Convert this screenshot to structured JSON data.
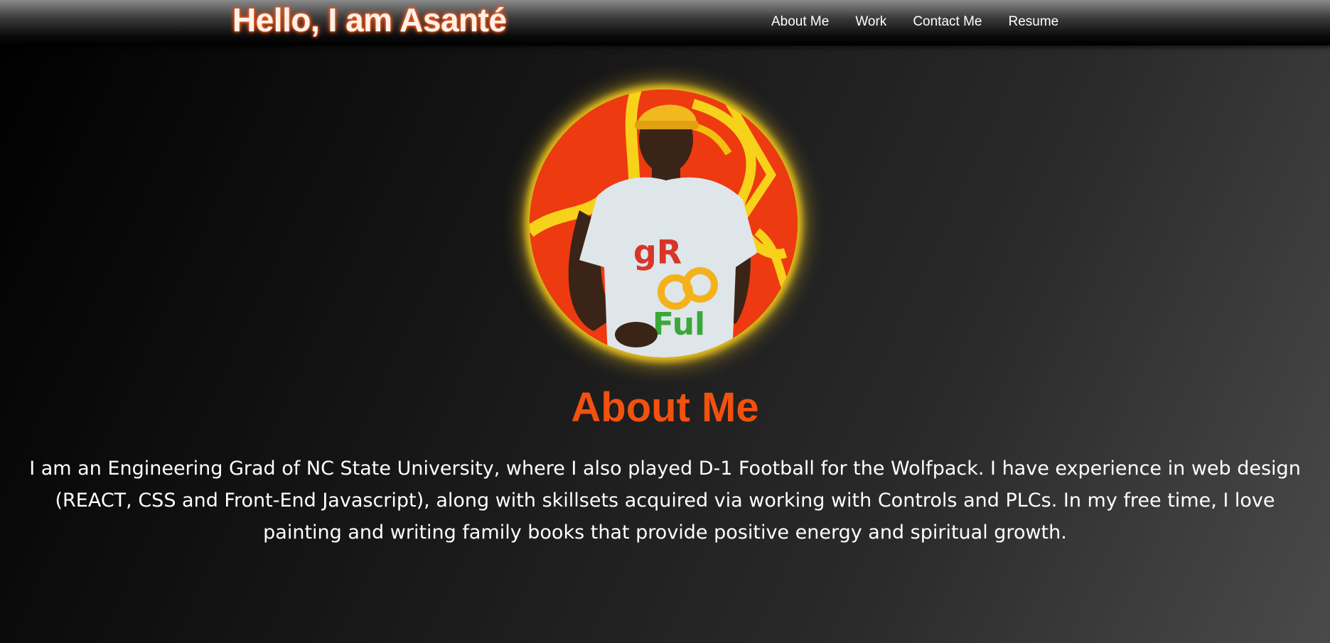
{
  "header": {
    "brand": "Hello, I am Asanté",
    "nav": [
      {
        "label": "About Me"
      },
      {
        "label": "Work"
      },
      {
        "label": "Contact Me"
      },
      {
        "label": "Resume"
      }
    ]
  },
  "profile": {
    "image_icon": "profile-photo",
    "shirt_text_top": "gR",
    "shirt_text_bottom": "Ful"
  },
  "about": {
    "title": "About Me",
    "text": "I am an Engineering Grad of NC State University, where I also played D-1 Football for the Wolfpack. I have experience in web design (REACT, CSS and Front-End Javascript), along with skillsets acquired via working with Controls and PLCs. In my free time, I love painting and writing family books that provide positive energy and spiritual growth."
  },
  "colors": {
    "accent": "#f2510f",
    "glow": "#e8c21a",
    "nav_text": "#ffffff"
  }
}
